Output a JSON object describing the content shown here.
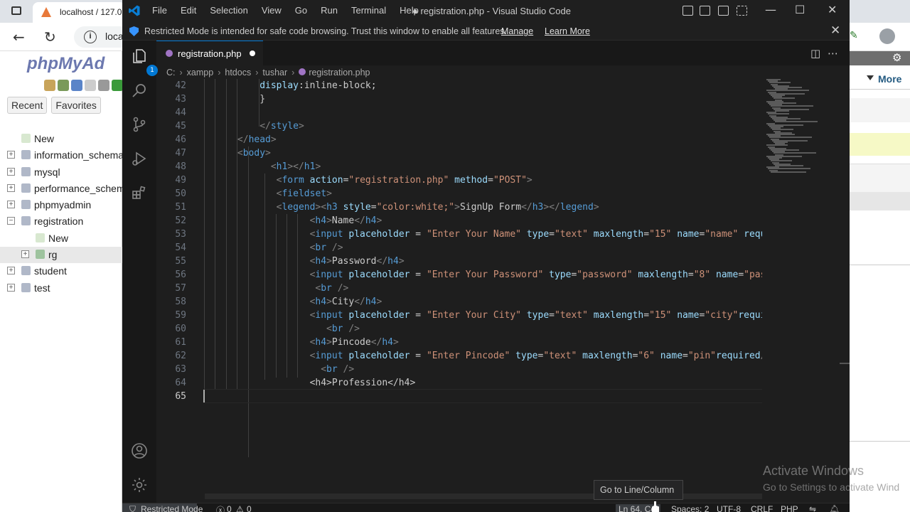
{
  "browser": {
    "tab_title": "localhost / 127.0",
    "url": "local",
    "right_more": "More"
  },
  "pma": {
    "logo_main": "phpMyAd",
    "recent_label": "Recent",
    "favorites_label": "Favorites",
    "tree": [
      {
        "label": "New",
        "level": 0,
        "type": "new"
      },
      {
        "label": "information_schema",
        "level": 0,
        "type": "db"
      },
      {
        "label": "mysql",
        "level": 0,
        "type": "db"
      },
      {
        "label": "performance_schema",
        "level": 0,
        "type": "db"
      },
      {
        "label": "phpmyadmin",
        "level": 0,
        "type": "db"
      },
      {
        "label": "registration",
        "level": 0,
        "type": "db-open"
      },
      {
        "label": "New",
        "level": 1,
        "type": "new"
      },
      {
        "label": "rg",
        "level": 1,
        "type": "table"
      },
      {
        "label": "student",
        "level": 0,
        "type": "db"
      },
      {
        "label": "test",
        "level": 0,
        "type": "db"
      }
    ]
  },
  "vscode": {
    "menu": [
      "File",
      "Edit",
      "Selection",
      "View",
      "Go",
      "Run",
      "Terminal",
      "Help"
    ],
    "window_title": "● registration.php - Visual Studio Code",
    "banner": {
      "message": "Restricted Mode is intended for safe code browsing. Trust this window to enable all features.",
      "manage": "Manage",
      "learn_more": "Learn More"
    },
    "explorer_badge": "1",
    "tab": {
      "label": "registration.php"
    },
    "breadcrumb": [
      "C:",
      "xampp",
      "htdocs",
      "tushar",
      "registration.php"
    ],
    "current_line": 65,
    "lines": [
      {
        "n": 42,
        "indent": 10,
        "tokens": [
          [
            "t-prop",
            "display"
          ],
          [
            "",
            "colon"
          ],
          [
            "",
            "inline-block;"
          ]
        ]
      },
      {
        "n": 43,
        "indent": 10,
        "tokens": [
          [
            "",
            "}"
          ]
        ]
      },
      {
        "n": 44,
        "indent": 0,
        "tokens": []
      },
      {
        "n": 45,
        "indent": 10,
        "tokens": [
          [
            "t-brk",
            "</"
          ],
          [
            "t-tag",
            "style"
          ],
          [
            "t-brk",
            ">"
          ]
        ]
      },
      {
        "n": 46,
        "indent": 6,
        "tokens": [
          [
            "t-brk",
            "</"
          ],
          [
            "t-tag",
            "head"
          ],
          [
            "t-brk",
            ">"
          ]
        ]
      },
      {
        "n": 47,
        "indent": 6,
        "tokens": [
          [
            "t-brk",
            "<"
          ],
          [
            "t-tag",
            "body"
          ],
          [
            "t-brk",
            ">"
          ]
        ]
      },
      {
        "n": 48,
        "indent": 12,
        "tokens": [
          [
            "t-brk",
            "<"
          ],
          [
            "t-tag",
            "h1"
          ],
          [
            "t-brk",
            "></"
          ],
          [
            "t-tag",
            "h1"
          ],
          [
            "t-brk",
            ">"
          ]
        ]
      },
      {
        "n": 49,
        "indent": 13,
        "tokens": [
          [
            "t-brk",
            "<"
          ],
          [
            "t-tag",
            "form"
          ],
          [
            "",
            ""
          ],
          [
            "t-attr",
            " action"
          ],
          [
            "",
            "="
          ],
          [
            "t-str",
            "\"registration.php\""
          ],
          [
            "t-attr",
            " method"
          ],
          [
            "",
            "="
          ],
          [
            "t-str",
            "\"POST\""
          ],
          [
            "t-brk",
            ">"
          ]
        ]
      },
      {
        "n": 50,
        "indent": 13,
        "tokens": [
          [
            "t-brk",
            "<"
          ],
          [
            "t-tag",
            "fieldset"
          ],
          [
            "t-brk",
            ">"
          ]
        ]
      },
      {
        "n": 51,
        "indent": 13,
        "tokens": [
          [
            "t-brk",
            "<"
          ],
          [
            "t-tag",
            "legend"
          ],
          [
            "t-brk",
            "><"
          ],
          [
            "t-tag",
            "h3"
          ],
          [
            "t-attr",
            " style"
          ],
          [
            "",
            "="
          ],
          [
            "t-str",
            "\"color:white;\""
          ],
          [
            "t-brk",
            ">"
          ],
          [
            "",
            "SignUp Form"
          ],
          [
            "t-brk",
            "</"
          ],
          [
            "t-tag",
            "h3"
          ],
          [
            "t-brk",
            "></"
          ],
          [
            "t-tag",
            "legend"
          ],
          [
            "t-brk",
            ">"
          ]
        ]
      },
      {
        "n": 52,
        "indent": 19,
        "tokens": [
          [
            "t-brk",
            "<"
          ],
          [
            "t-tag",
            "h4"
          ],
          [
            "t-brk",
            ">"
          ],
          [
            "",
            "Name"
          ],
          [
            "t-brk",
            "</"
          ],
          [
            "t-tag",
            "h4"
          ],
          [
            "t-brk",
            ">"
          ]
        ]
      },
      {
        "n": 53,
        "indent": 19,
        "tokens": [
          [
            "t-brk",
            "<"
          ],
          [
            "t-tag",
            "input"
          ],
          [
            "t-attr",
            " placeholder"
          ],
          [
            "",
            " = "
          ],
          [
            "t-str",
            "\"Enter Your Name\""
          ],
          [
            "t-attr",
            " type"
          ],
          [
            "",
            "="
          ],
          [
            "t-str",
            "\"text\""
          ],
          [
            "t-attr",
            " maxlength"
          ],
          [
            "",
            "="
          ],
          [
            "t-str",
            "\"15\""
          ],
          [
            "t-attr",
            " name"
          ],
          [
            "",
            "="
          ],
          [
            "t-str",
            "\"name\""
          ],
          [
            "t-attr",
            " requi"
          ]
        ]
      },
      {
        "n": 54,
        "indent": 19,
        "tokens": [
          [
            "t-brk",
            "<"
          ],
          [
            "t-tag",
            "br"
          ],
          [
            "t-brk",
            " />"
          ]
        ]
      },
      {
        "n": 55,
        "indent": 19,
        "tokens": [
          [
            "t-brk",
            "<"
          ],
          [
            "t-tag",
            "h4"
          ],
          [
            "t-brk",
            ">"
          ],
          [
            "",
            "Password"
          ],
          [
            "t-brk",
            "</"
          ],
          [
            "t-tag",
            "h4"
          ],
          [
            "t-brk",
            ">"
          ]
        ]
      },
      {
        "n": 56,
        "indent": 19,
        "tokens": [
          [
            "t-brk",
            "<"
          ],
          [
            "t-tag",
            "input"
          ],
          [
            "t-attr",
            " placeholder"
          ],
          [
            "",
            " = "
          ],
          [
            "t-str",
            "\"Enter Your Password\""
          ],
          [
            "t-attr",
            " type"
          ],
          [
            "",
            "="
          ],
          [
            "t-str",
            "\"password\""
          ],
          [
            "t-attr",
            " maxlength"
          ],
          [
            "",
            "="
          ],
          [
            "t-str",
            "\"8\""
          ],
          [
            "t-attr",
            " name"
          ],
          [
            "",
            "="
          ],
          [
            "t-str",
            "\"pass"
          ]
        ]
      },
      {
        "n": 57,
        "indent": 20,
        "tokens": [
          [
            "t-brk",
            "<"
          ],
          [
            "t-tag",
            "br"
          ],
          [
            "t-brk",
            " />"
          ]
        ]
      },
      {
        "n": 58,
        "indent": 19,
        "tokens": [
          [
            "t-brk",
            "<"
          ],
          [
            "t-tag",
            "h4"
          ],
          [
            "t-brk",
            ">"
          ],
          [
            "",
            "City"
          ],
          [
            "t-brk",
            "</"
          ],
          [
            "t-tag",
            "h4"
          ],
          [
            "t-brk",
            ">"
          ]
        ]
      },
      {
        "n": 59,
        "indent": 19,
        "tokens": [
          [
            "t-brk",
            "<"
          ],
          [
            "t-tag",
            "input"
          ],
          [
            "t-attr",
            " placeholder"
          ],
          [
            "",
            " = "
          ],
          [
            "t-str",
            "\"Enter Your City\""
          ],
          [
            "t-attr",
            " type"
          ],
          [
            "",
            "="
          ],
          [
            "t-str",
            "\"text\""
          ],
          [
            "t-attr",
            " maxlength"
          ],
          [
            "",
            "="
          ],
          [
            "t-str",
            "\"15\""
          ],
          [
            "t-attr",
            " name"
          ],
          [
            "",
            "="
          ],
          [
            "t-str",
            "\"city\""
          ],
          [
            "t-attr",
            "requir"
          ]
        ]
      },
      {
        "n": 60,
        "indent": 22,
        "tokens": [
          [
            "t-brk",
            "<"
          ],
          [
            "t-tag",
            "br"
          ],
          [
            "t-brk",
            " />"
          ]
        ]
      },
      {
        "n": 61,
        "indent": 19,
        "tokens": [
          [
            "t-brk",
            "<"
          ],
          [
            "t-tag",
            "h4"
          ],
          [
            "t-brk",
            ">"
          ],
          [
            "",
            "Pincode"
          ],
          [
            "t-brk",
            "</"
          ],
          [
            "t-tag",
            "h4"
          ],
          [
            "t-brk",
            ">"
          ]
        ]
      },
      {
        "n": 62,
        "indent": 19,
        "tokens": [
          [
            "t-brk",
            "<"
          ],
          [
            "t-tag",
            "input"
          ],
          [
            "t-attr",
            " placeholder"
          ],
          [
            "",
            " = "
          ],
          [
            "t-str",
            "\"Enter Pincode\""
          ],
          [
            "t-attr",
            " type"
          ],
          [
            "",
            "="
          ],
          [
            "t-str",
            "\"text\""
          ],
          [
            "t-attr",
            " maxlength"
          ],
          [
            "",
            "="
          ],
          [
            "t-str",
            "\"6\""
          ],
          [
            "t-attr",
            " name"
          ],
          [
            "",
            "="
          ],
          [
            "t-str",
            "\"pin\""
          ],
          [
            "t-attr",
            "required"
          ],
          [
            "t-brk",
            "/>"
          ]
        ]
      },
      {
        "n": 63,
        "indent": 21,
        "tokens": [
          [
            "t-brk",
            "<"
          ],
          [
            "t-tag",
            "br"
          ],
          [
            "t-brk",
            " />"
          ]
        ]
      },
      {
        "n": 64,
        "indent": 19,
        "tokens": [
          [
            "",
            "<h4>Profession</h4>"
          ]
        ]
      },
      {
        "n": 65,
        "indent": 0,
        "tokens": []
      }
    ],
    "tooltip": "Go to Line/Column",
    "status": {
      "mode": "Restricted Mode",
      "errors": "0",
      "warnings": "0",
      "position": "Ln 64, Col",
      "spaces": "Spaces: 2",
      "encoding": "UTF-8",
      "eol": "CRLF",
      "language": "PHP"
    }
  },
  "windows": {
    "activate_title": "Activate Windows",
    "activate_sub": "Go to Settings to activate Wind"
  },
  "colors": {
    "editor_bg": "#1e1e1e",
    "accent": "#0078d4",
    "tag": "#569cd6",
    "attr": "#9cdcfe",
    "string": "#ce9178"
  }
}
